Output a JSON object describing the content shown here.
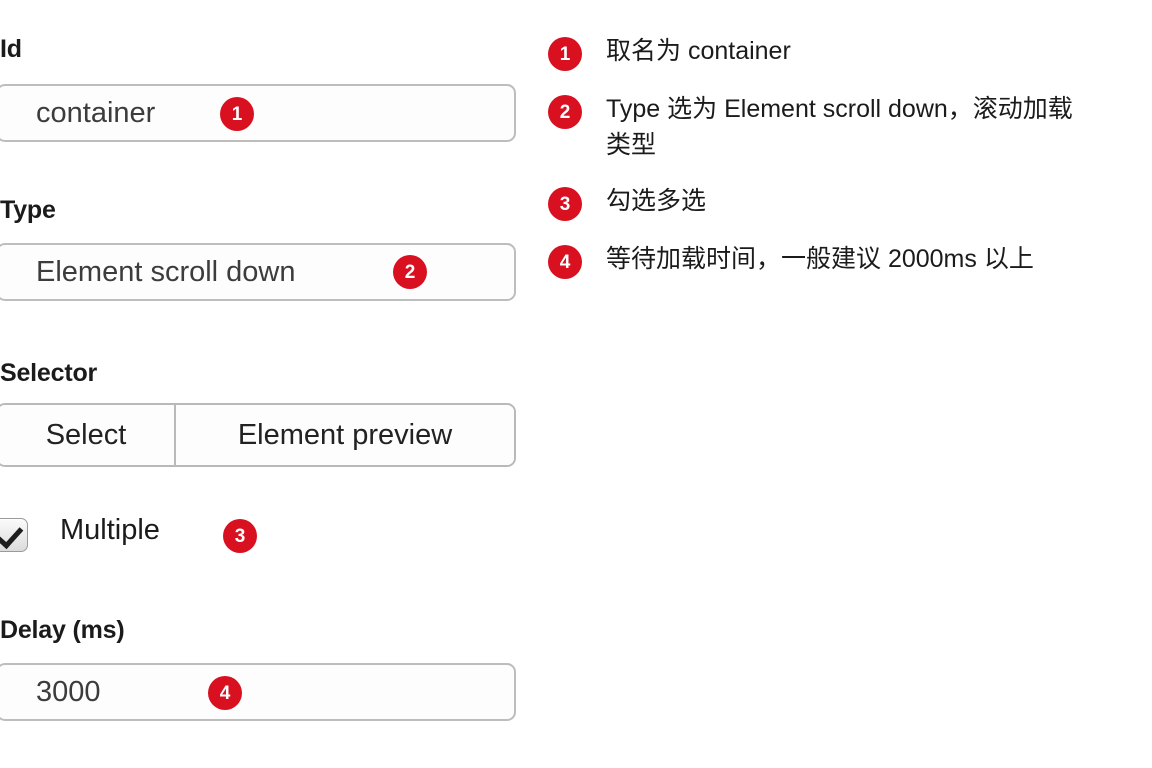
{
  "form": {
    "fields": [
      {
        "label": "Id",
        "value": "container",
        "badge": "1"
      },
      {
        "label": "Type",
        "value": "Element scroll down",
        "badge": "2"
      }
    ],
    "selector": {
      "label": "Selector",
      "select_label": "Select",
      "preview_label": "Element preview"
    },
    "multiple": {
      "label": "Multiple",
      "checked": true,
      "badge": "3"
    },
    "delay": {
      "label": "Delay (ms)",
      "value": "3000",
      "badge": "4"
    }
  },
  "annotations": [
    {
      "number": "1",
      "text": "取名为 container"
    },
    {
      "number": "2",
      "text": "Type 选为 Element scroll down，滚动加载类型"
    },
    {
      "number": "3",
      "text": "勾选多选"
    },
    {
      "number": "4",
      "text": "等待加载时间，一般建议 2000ms 以上"
    }
  ],
  "colors": {
    "badge_red": "#d81020",
    "background": "#ffffff",
    "label_text": "#1b1b1b",
    "input_border": "#bdbdbd"
  }
}
